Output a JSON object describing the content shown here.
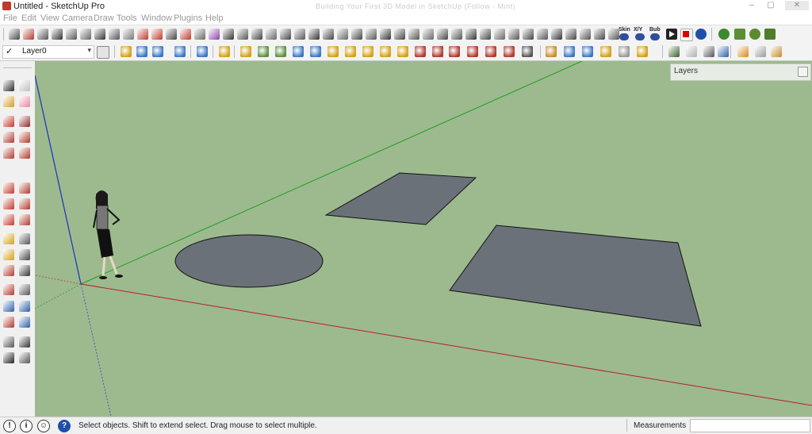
{
  "window": {
    "title": "Untitled - SketchUp Pro",
    "blurred_title": "Building Your First 3D Model in SketchUp (Follow - Mint)",
    "controls": [
      "–",
      "▢",
      "✕"
    ]
  },
  "menu": [
    "File",
    "Edit",
    "View",
    "Camera",
    "Draw",
    "Tools",
    "Window",
    "Plugins",
    "Help"
  ],
  "toolbar_top": {
    "icon_colors": [
      "#4a4a4a",
      "#b03a2e",
      "#555",
      "#333",
      "#555",
      "#666",
      "#333",
      "#555",
      "#777",
      "#c0392b",
      "#c0392b",
      "#444",
      "#c0392b",
      "#666",
      "#8e44ad",
      "#333",
      "#555",
      "#444",
      "#666",
      "#444",
      "#555",
      "#333",
      "#444",
      "#666",
      "#444",
      "#555",
      "#333",
      "#444",
      "#555",
      "#666",
      "#444",
      "#555",
      "#333",
      "#444",
      "#666",
      "#555",
      "#444",
      "#555",
      "#333",
      "#444",
      "#555",
      "#444",
      "#555"
    ],
    "labeled_buttons": [
      "Skin",
      "X/Y",
      "Bub"
    ],
    "extra_icons": [
      "play-icon",
      "stop-icon",
      "refresh-icon",
      "plant-icon",
      "grass-icon",
      "tree-icon",
      "tree2-icon"
    ]
  },
  "toolbar_second": {
    "layer_select": {
      "check": "✓",
      "value": "Layer0",
      "caret": "▾"
    },
    "icon_colors": [
      "#d4a017",
      "#3a76c4",
      "#3a76c4",
      "#3a76c4",
      "#3a76c4",
      "#d4a017",
      "#d4a017",
      "#5a8f3c",
      "#5a8f3c",
      "#3a76c4",
      "#3a76c4",
      "#d4a017",
      "#d4a017",
      "#d4a017",
      "#d4a017",
      "#d4a017",
      "#b03a2e",
      "#b03a2e",
      "#b03a2e",
      "#b03a2e",
      "#b03a2e",
      "#b03a2e",
      "#555",
      "#c98b2b",
      "#3a76c4",
      "#3a76c4",
      "#d4a017",
      "#999",
      "#d4a017"
    ]
  },
  "left_tools": [
    "select-icon",
    "component-icon",
    "paint-bucket-icon",
    "eraser-icon",
    "rectangle-icon",
    "line-icon",
    "circle-icon",
    "arc-icon",
    "polygon-icon",
    "freehand-icon",
    "move-icon",
    "pushpull-icon",
    "rotate-icon",
    "followme-icon",
    "scale-icon",
    "offset-icon",
    "tape-icon",
    "dimension-icon",
    "protractor-icon",
    "text-icon",
    "axes-icon",
    "3dtext-icon",
    "orbit-icon",
    "pan-icon",
    "zoom-icon",
    "zoom-window-icon",
    "zoom-extents-icon",
    "previous-icon",
    "position-camera-icon",
    "look-around-icon",
    "walk-icon",
    "section-plane-icon"
  ],
  "viewport": {
    "background": "#9dba8f",
    "shape_fill": "#6b7178",
    "shapes": [
      "ellipse-face",
      "rectangle-face-small",
      "rectangle-face-large"
    ],
    "figure": "scale-figure"
  },
  "layers_panel": {
    "title": "Layers"
  },
  "status": {
    "icons": [
      "!",
      "i",
      "☺",
      "?"
    ],
    "message": "Select objects. Shift to extend select. Drag mouse to select multiple.",
    "measurements_label": "Measurements",
    "measurements_value": ""
  }
}
